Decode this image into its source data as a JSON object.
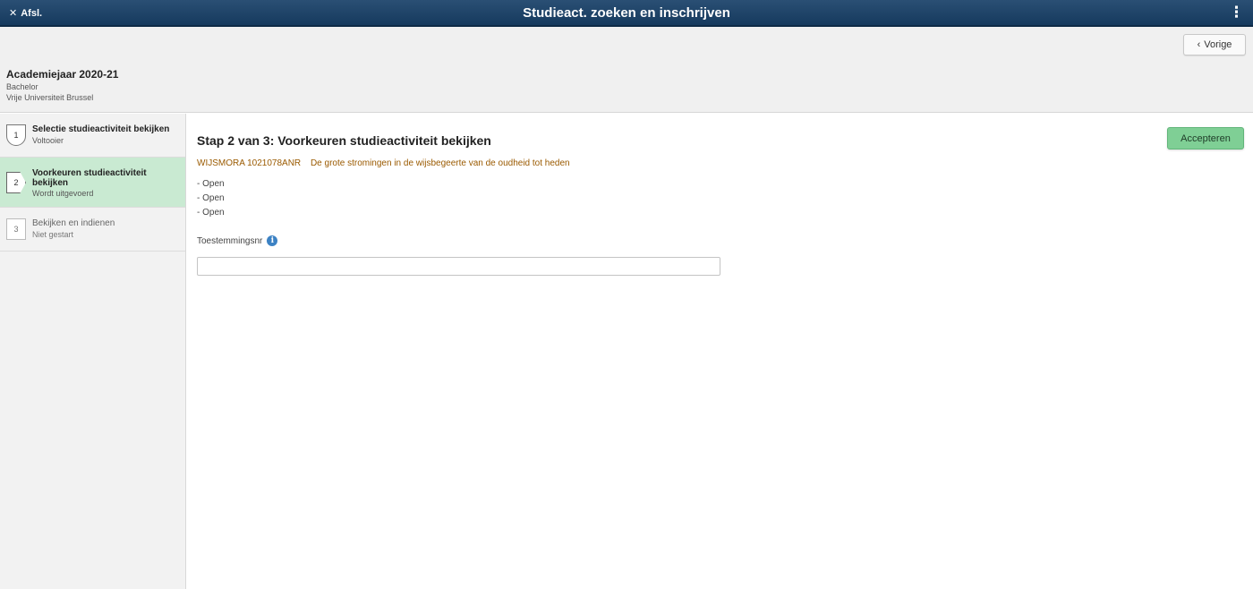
{
  "banner": {
    "home_label": "Afsl.",
    "title": "Studieact. zoeken en inschrijven",
    "menu_glyph": "⋮"
  },
  "header": {
    "prev_label": "Vorige",
    "academic_year": "Academiejaar 2020-21",
    "career": "Bachelor",
    "institution": "Vrije Universiteit Brussel"
  },
  "steps": [
    {
      "number": "1",
      "title": "Selectie studieactiviteit bekijken",
      "status": "Voltooier"
    },
    {
      "number": "2",
      "title": "Voorkeuren studieactiviteit bekijken",
      "status": "Wordt uitgevoerd"
    },
    {
      "number": "3",
      "title": "Bekijken en indienen",
      "status": "Niet gestart"
    }
  ],
  "main": {
    "page_title": "Stap 2 van 3: Voorkeuren studieactiviteit bekijken",
    "accept_label": "Accepteren",
    "course_code": "WIJSMORA 1021078ANR",
    "course_name": "De grote stromingen in de wijsbegeerte van de oudheid tot heden",
    "options": [
      "- Open",
      "- Open",
      "- Open"
    ],
    "permission_label": "Toestemmingsnr",
    "permission_value": ""
  },
  "colors": {
    "banner": "#1e4468",
    "active_step": "#c9ead2",
    "accept_button": "#7fcf95",
    "course_text": "#9a5a00",
    "info_icon": "#3c82c4"
  }
}
